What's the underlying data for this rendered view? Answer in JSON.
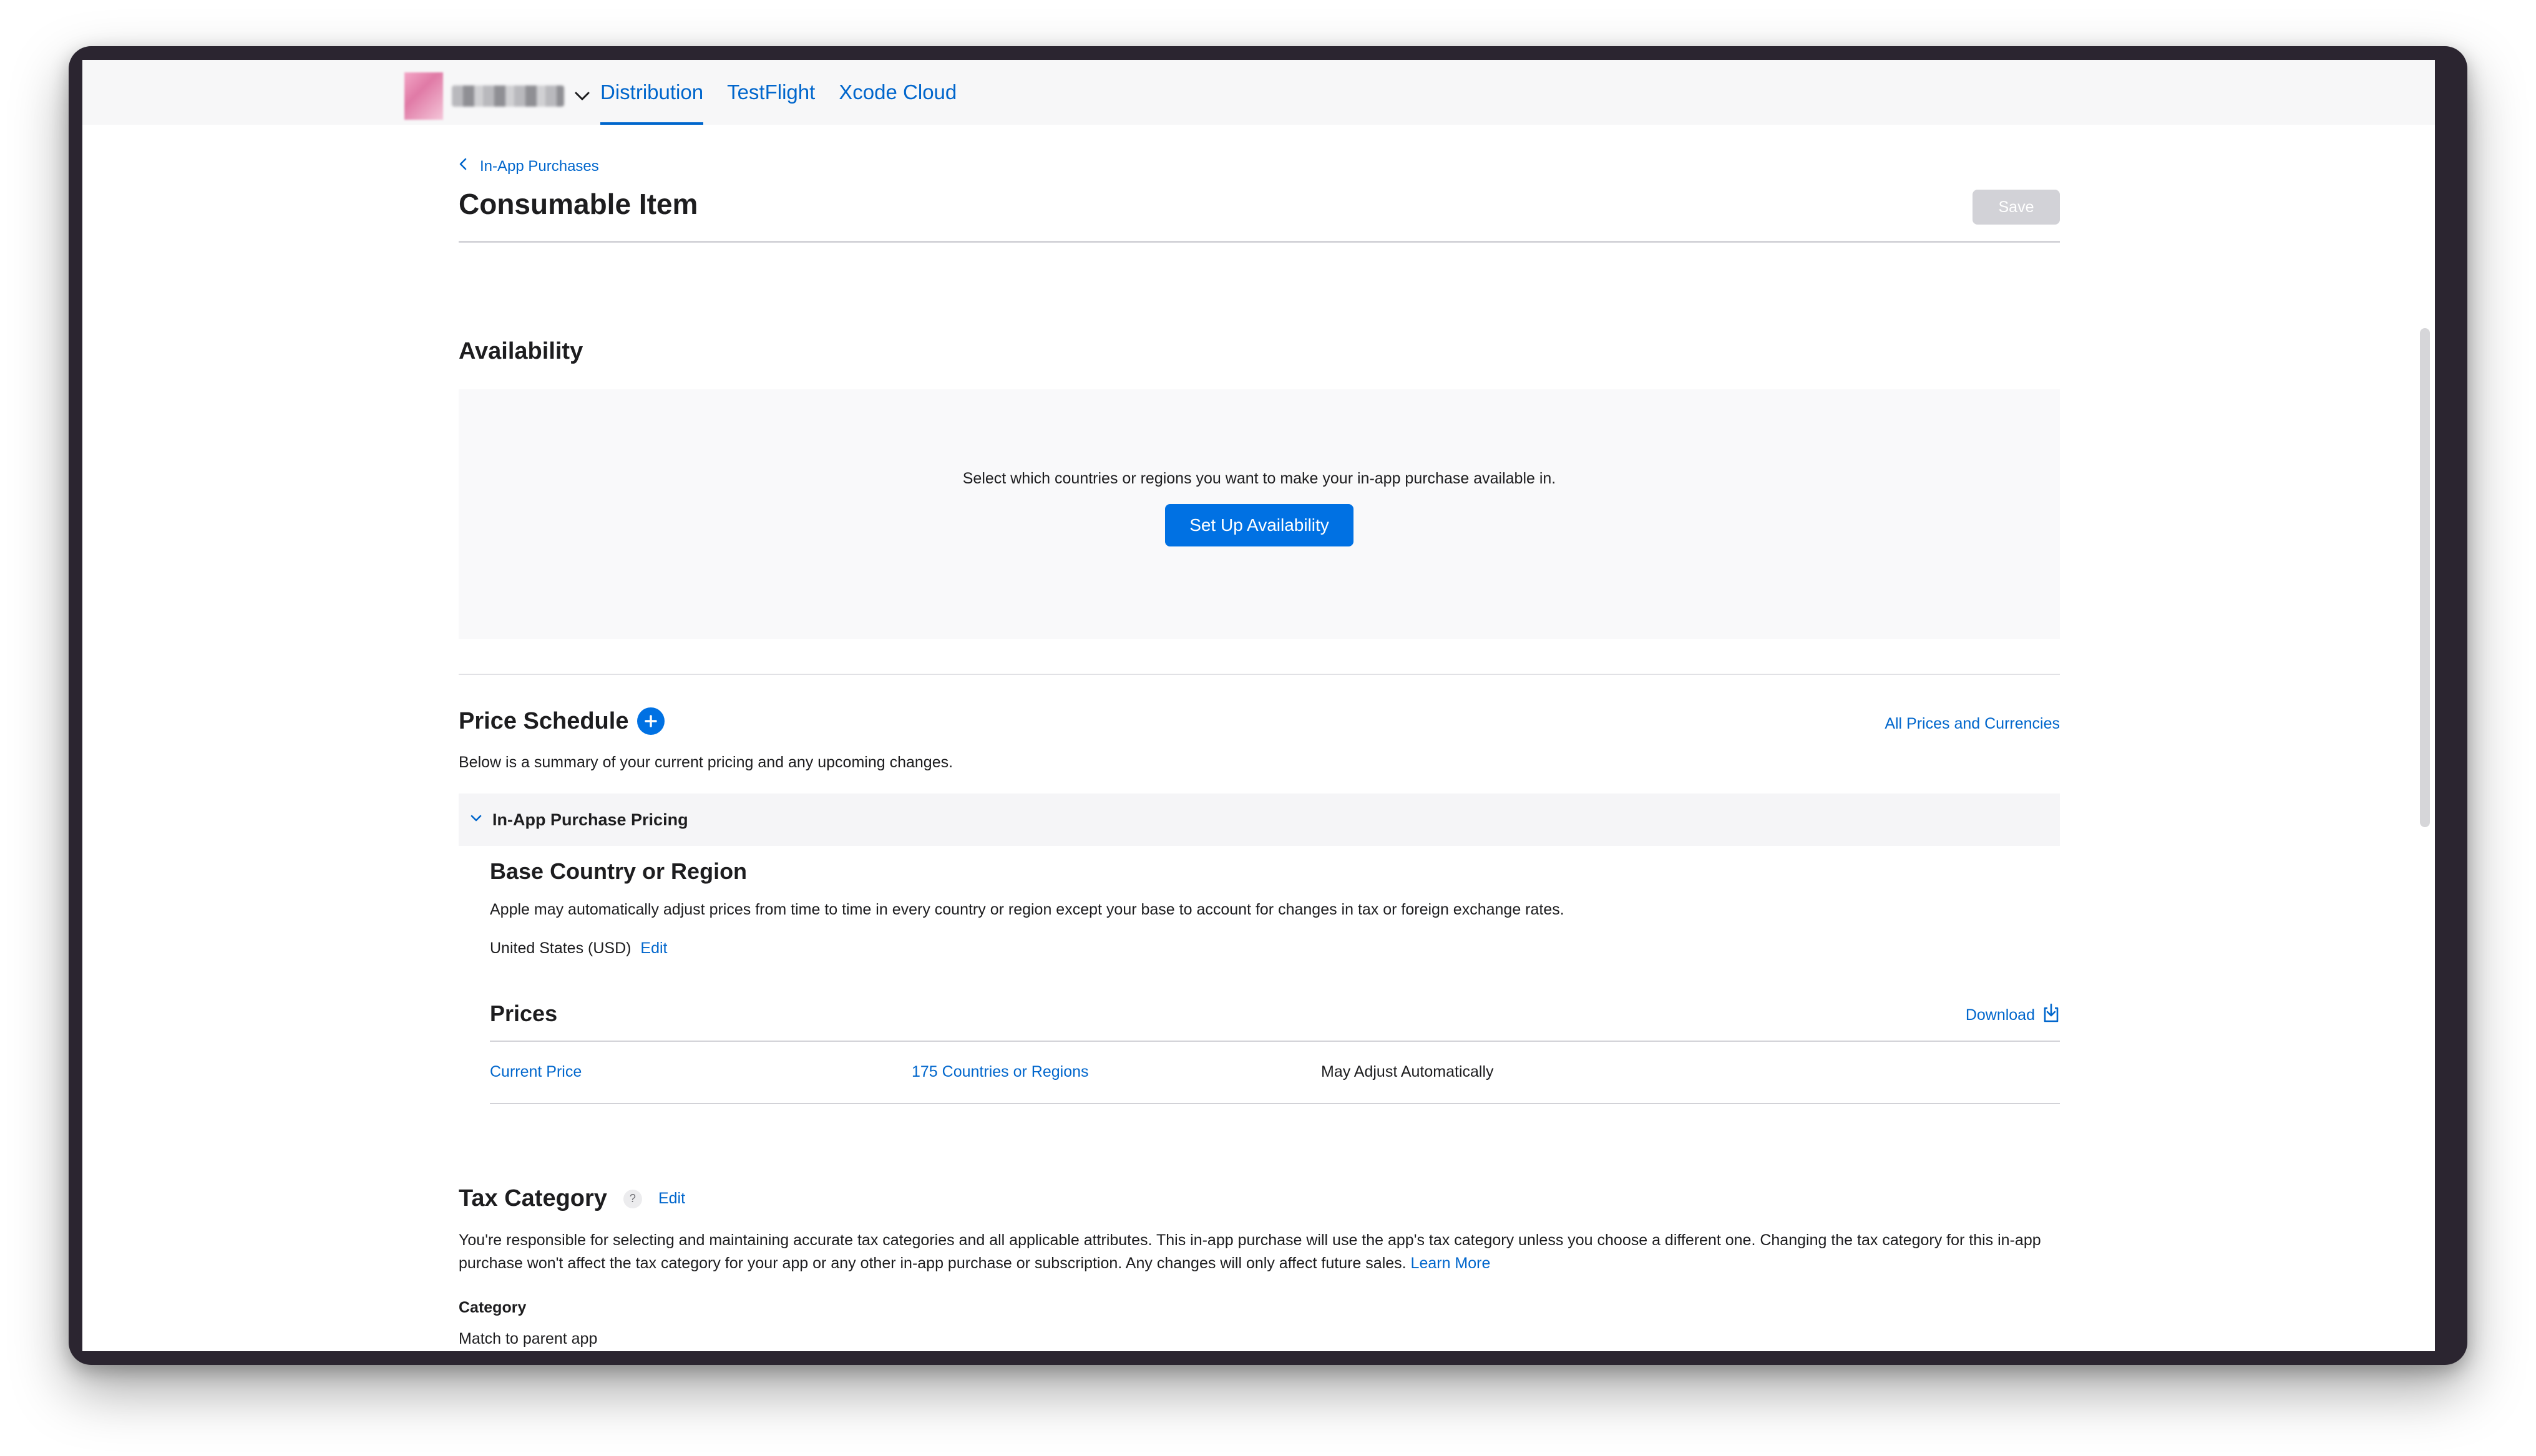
{
  "nav": {
    "tabs": [
      {
        "label": "Distribution",
        "active": true
      },
      {
        "label": "TestFlight",
        "active": false
      },
      {
        "label": "Xcode Cloud",
        "active": false
      }
    ]
  },
  "breadcrumb": {
    "label": "In-App Purchases"
  },
  "page": {
    "title": "Consumable Item",
    "save_label": "Save"
  },
  "availability": {
    "title": "Availability",
    "description": "Select which countries or regions you want to make your in-app purchase available in.",
    "button_label": "Set Up Availability"
  },
  "price_schedule": {
    "title": "Price Schedule",
    "all_prices_link": "All Prices and Currencies",
    "subtitle": "Below is a summary of your current pricing and any upcoming changes.",
    "pricing_header": "In-App Purchase Pricing",
    "base_region_title": "Base Country or Region",
    "base_region_desc": "Apple may automatically adjust prices from time to time in every country or region except your base to account for changes in tax or foreign exchange rates.",
    "base_region_value": "United States (USD)",
    "edit_label": "Edit",
    "prices_title": "Prices",
    "download_label": "Download",
    "row": {
      "current_price": "Current Price",
      "countries": "175 Countries or Regions",
      "adjust": "May Adjust Automatically"
    }
  },
  "tax": {
    "title": "Tax Category",
    "help": "?",
    "edit_label": "Edit",
    "description": "You're responsible for selecting and maintaining accurate tax categories and all applicable attributes. This in-app purchase will use the app's tax category unless you choose a different one. Changing the tax category for this in-app purchase won't affect the tax category for your app or any other in-app purchase or subscription. Any changes will only affect future sales.",
    "learn_more": "Learn More",
    "category_label": "Category",
    "category_value": "Match to parent app"
  },
  "colors": {
    "accent": "#0066cc",
    "primary_button": "#0071e3",
    "disabled_button": "#d2d2d7"
  }
}
